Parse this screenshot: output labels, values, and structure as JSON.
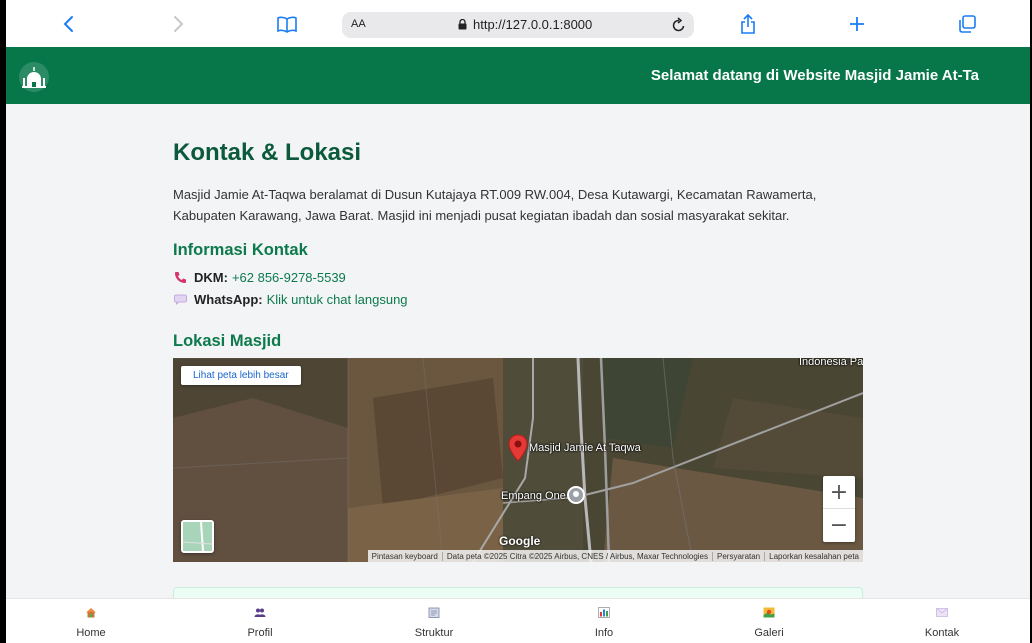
{
  "browser": {
    "text_size_label": "AA",
    "url": "http://127.0.0.1:8000"
  },
  "header": {
    "welcome": "Selamat datang di Website Masjid Jamie At-Ta"
  },
  "content": {
    "title": "Kontak & Lokasi",
    "intro": "Masjid Jamie At-Taqwa beralamat di Dusun Kutajaya RT.009 RW.004, Desa Kutawargi, Kecamatan Rawamerta, Kabupaten Karawang, Jawa Barat. Masjid ini menjadi pusat kegiatan ibadah dan sosial masyarakat sekitar.",
    "contact_heading": "Informasi Kontak",
    "dkm_label": "DKM:",
    "dkm_value": "+62 856-9278-5539",
    "wa_label": "WhatsApp:",
    "wa_value": "Klik untuk chat langsung",
    "location_heading": "Lokasi Masjid"
  },
  "map": {
    "larger_map_label": "Lihat peta lebih besar",
    "place_label": "Masjid Jamie At Taqwa",
    "nearby_label": "Empang One",
    "region_label": "Indonesia Pa",
    "provider": "Google",
    "zoom_in": "+",
    "zoom_out": "−",
    "attribution": [
      "Pintasan keyboard",
      "Data peta ©2025 Citra ©2025 Airbus, CNES / Airbus, Maxar Technologies",
      "Persyaratan",
      "Laporkan kesalahan peta"
    ]
  },
  "nav": {
    "home": "Home",
    "profil": "Profil",
    "struktur": "Struktur",
    "info": "Info",
    "galeri": "Galeri",
    "kontak": "Kontak"
  },
  "colors": {
    "brand_green": "#07774a",
    "heading_green": "#0b5a3b",
    "link_green": "#0c7a4c"
  }
}
